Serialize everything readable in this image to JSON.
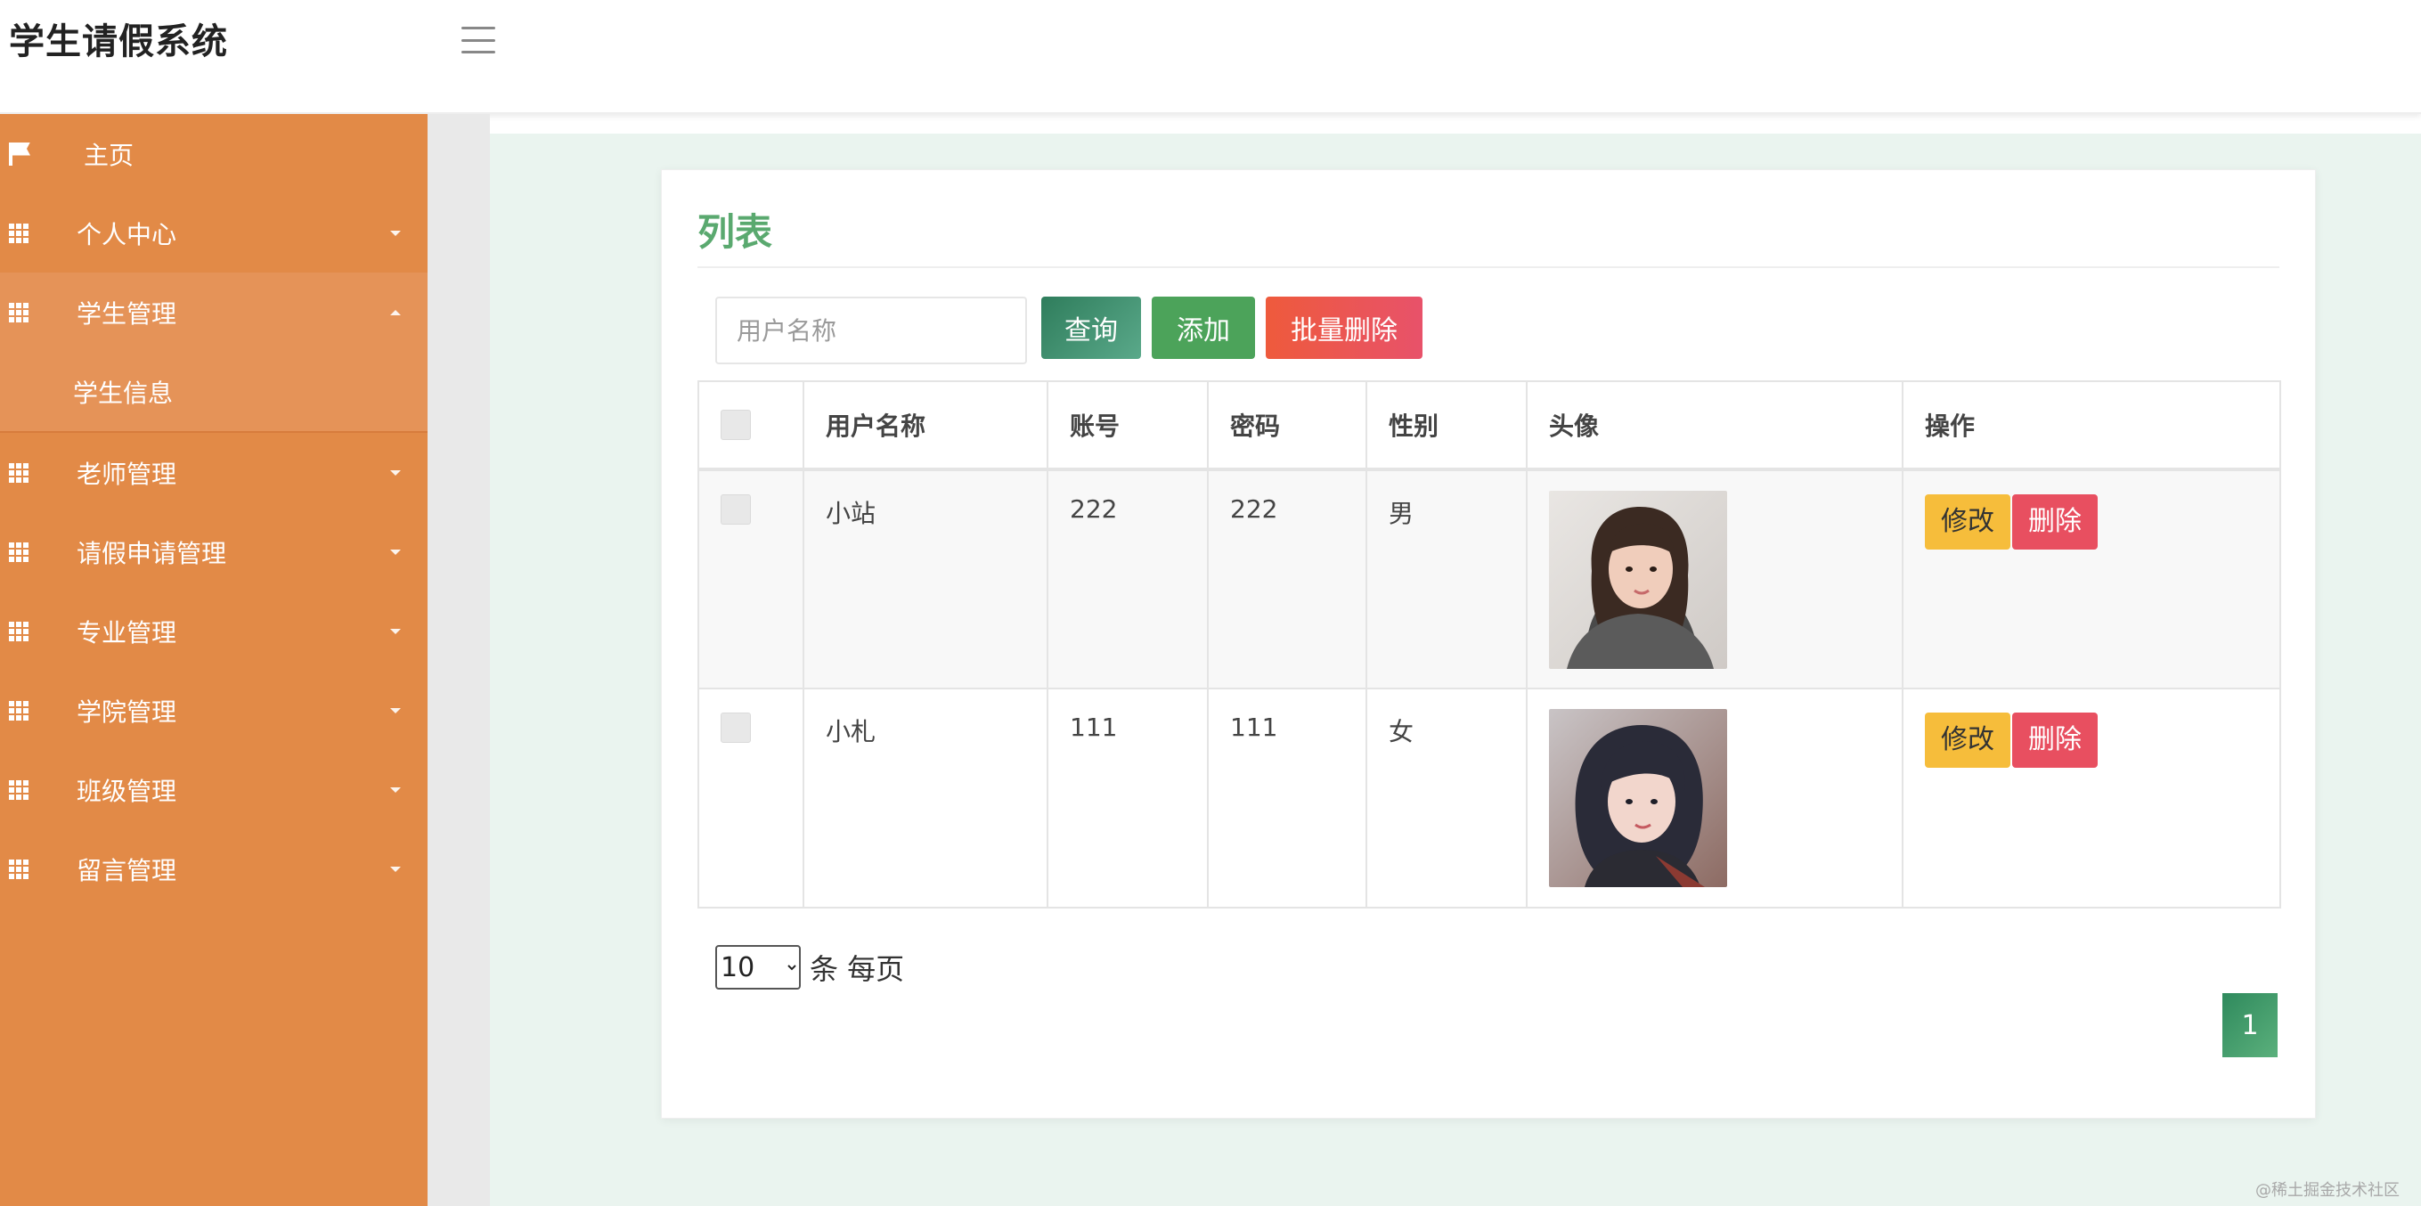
{
  "header": {
    "title": "学生请假系统"
  },
  "sidebar": {
    "items": [
      {
        "label": "主页"
      },
      {
        "label": "个人中心"
      },
      {
        "label": "学生管理",
        "children": [
          {
            "label": "学生信息"
          }
        ]
      },
      {
        "label": "老师管理"
      },
      {
        "label": "请假申请管理"
      },
      {
        "label": "专业管理"
      },
      {
        "label": "学院管理"
      },
      {
        "label": "班级管理"
      },
      {
        "label": "留言管理"
      }
    ]
  },
  "panel": {
    "title": "列表",
    "search": {
      "placeholder": "用户名称"
    },
    "buttons": {
      "query": "查询",
      "add": "添加",
      "batch_delete": "批量删除"
    },
    "table": {
      "columns": [
        "用户名称",
        "账号",
        "密码",
        "性别",
        "头像",
        "操作"
      ],
      "rows": [
        {
          "username": "小站",
          "account": "222",
          "password": "222",
          "gender": "男"
        },
        {
          "username": "小札",
          "account": "111",
          "password": "111",
          "gender": "女"
        }
      ],
      "actions": {
        "edit": "修改",
        "delete": "删除"
      }
    },
    "pagination": {
      "page_size": "10",
      "page_size_label": "条 每页",
      "current_page": "1"
    }
  },
  "watermark": "@稀土掘金技术社区"
}
